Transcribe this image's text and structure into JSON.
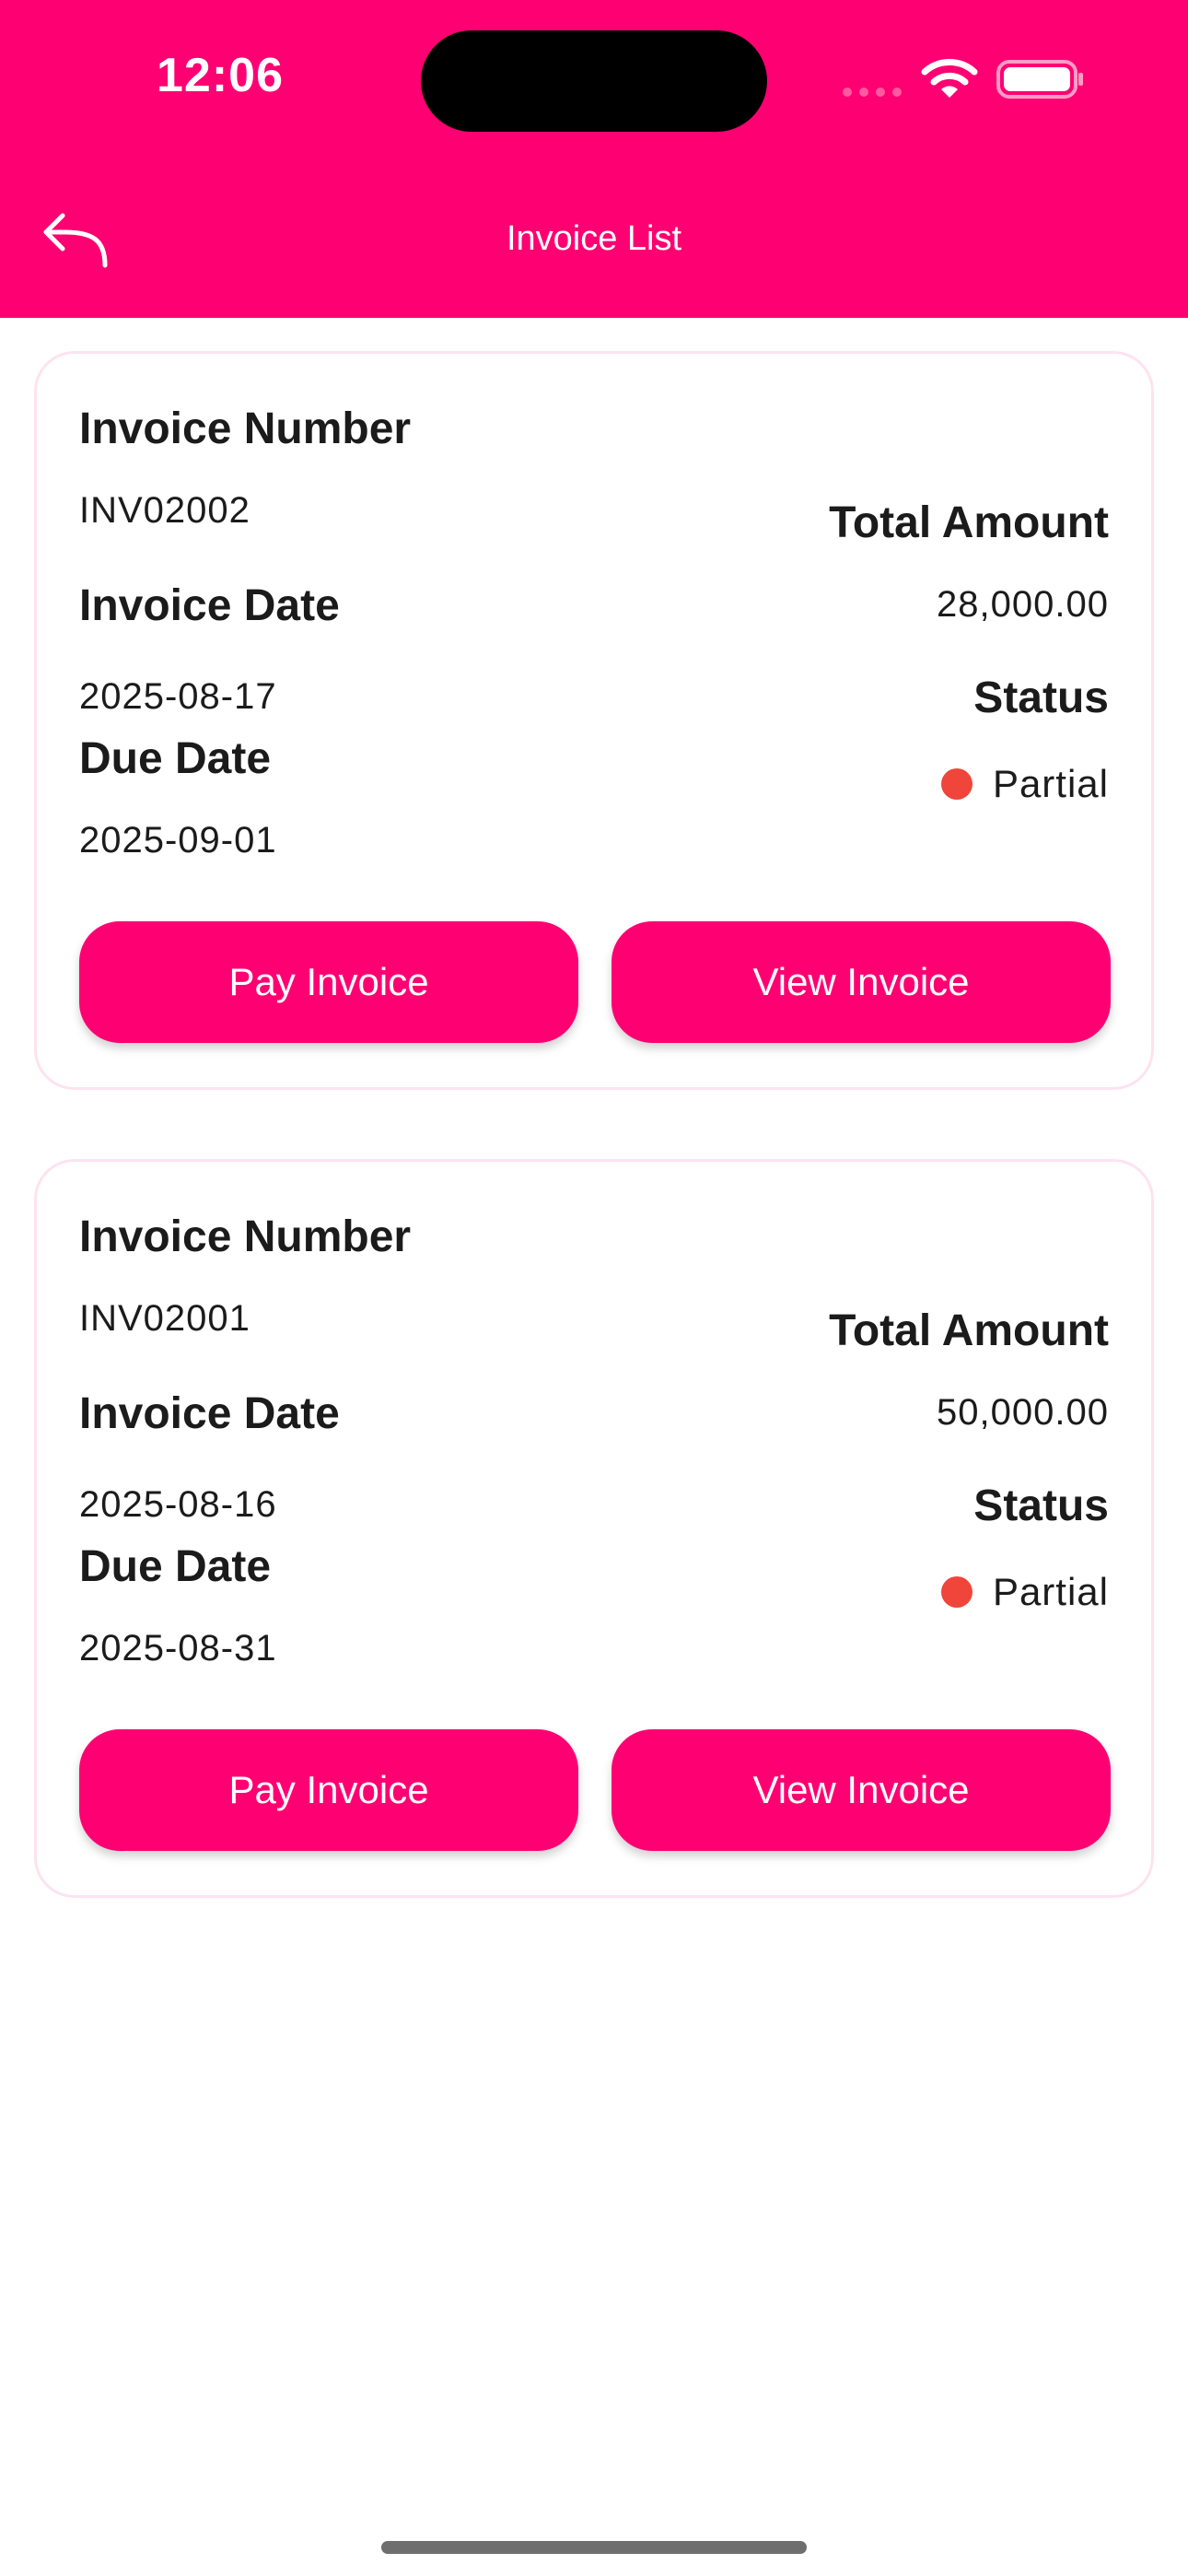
{
  "status_bar": {
    "time": "12:06"
  },
  "nav": {
    "title": "Invoice List",
    "back_icon": "back-arrow-icon"
  },
  "colors": {
    "brand": "#ff0073",
    "status_partial": "#f0453a"
  },
  "invoices": [
    {
      "number_label": "Invoice Number",
      "number": "INV02002",
      "date_label": "Invoice Date",
      "date": "2025-08-17",
      "due_label": "Due Date",
      "due": "2025-09-01",
      "total_label": "Total Amount",
      "total": "28,000.00",
      "status_label": "Status",
      "status": "Partial",
      "pay_label": "Pay Invoice",
      "view_label": "View Invoice"
    },
    {
      "number_label": "Invoice Number",
      "number": "INV02001",
      "date_label": "Invoice Date",
      "date": "2025-08-16",
      "due_label": "Due Date",
      "due": "2025-08-31",
      "total_label": "Total Amount",
      "total": "50,000.00",
      "status_label": "Status",
      "status": "Partial",
      "pay_label": "Pay Invoice",
      "view_label": "View Invoice"
    }
  ]
}
